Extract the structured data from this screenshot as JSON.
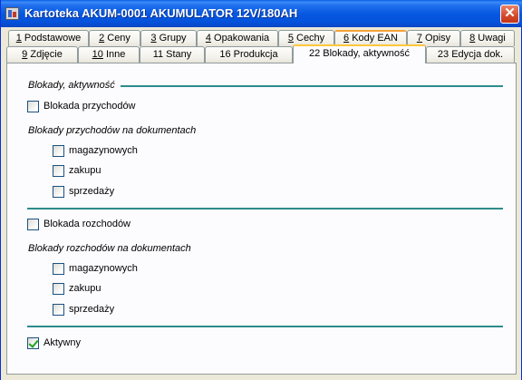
{
  "window": {
    "title": "Kartoteka  AKUM-0001  AKUMULATOR 12V/180AH",
    "close_glyph": "✕"
  },
  "tabs_row1": [
    {
      "key": "1",
      "label": " Podstawowe"
    },
    {
      "key": "2",
      "label": " Ceny"
    },
    {
      "key": "3",
      "label": " Grupy"
    },
    {
      "key": "4",
      "label": " Opakowania"
    },
    {
      "key": "5",
      "label": " Cechy"
    },
    {
      "key": "6",
      "label": " Kody EAN"
    },
    {
      "key": "7",
      "label": " Opisy"
    },
    {
      "key": "8",
      "label": " Uwagi"
    }
  ],
  "tabs_row2": [
    {
      "key": "9",
      "label": " Zdjęcie"
    },
    {
      "key": "10",
      "label": " Inne"
    },
    {
      "key": "",
      "label": "11 Stany"
    },
    {
      "key": "",
      "label": "16 Produkcja"
    },
    {
      "key": "",
      "label": "22 Blokady, aktywność"
    },
    {
      "key": "",
      "label": "23 Edycja dok."
    }
  ],
  "active_tab": "22 Blokady, aktywność",
  "content": {
    "section_title": "Blokady, aktywność",
    "income_block": {
      "label": "Blokada przychodów",
      "checked": false
    },
    "income_docs_title": "Blokady przychodów na dokumentach",
    "income_docs": [
      {
        "label": "magazynowych",
        "checked": false
      },
      {
        "label": "zakupu",
        "checked": false
      },
      {
        "label": "sprzedaży",
        "checked": false
      }
    ],
    "outgo_block": {
      "label": "Blokada rozchodów",
      "checked": false
    },
    "outgo_docs_title": "Blokady rozchodów na dokumentach",
    "outgo_docs": [
      {
        "label": "magazynowych",
        "checked": false
      },
      {
        "label": "zakupu",
        "checked": false
      },
      {
        "label": "sprzedaży",
        "checked": false
      }
    ],
    "active": {
      "label": "Aktywny",
      "checked": true
    }
  },
  "colors": {
    "title_bar": "#0556e0",
    "section_rule": "#2e8b8b",
    "active_tab_accent": "#ffc83c",
    "checkmark": "#21a121"
  }
}
